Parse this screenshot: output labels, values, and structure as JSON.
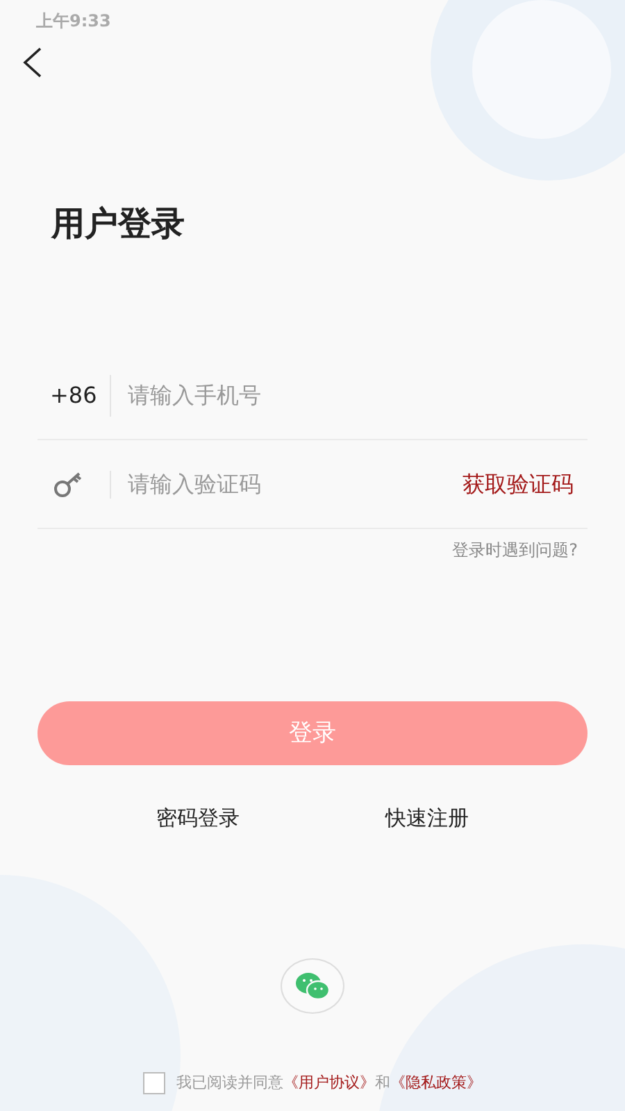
{
  "status_bar": {
    "time": "上午9:33"
  },
  "title": "用户登录",
  "phone": {
    "prefix": "+86",
    "placeholder": "请输入手机号"
  },
  "code": {
    "placeholder": "请输入验证码",
    "action": "获取验证码"
  },
  "help_link": "登录时遇到问题?",
  "login_button": {
    "label": "登录",
    "disabled": true
  },
  "links": [
    "密码登录",
    "快速注册"
  ],
  "agreement": {
    "checked": false,
    "text": "我已阅读并同意",
    "links": [
      "《用户协议》",
      "《隐私政策》"
    ],
    "conjunction": "和"
  }
}
